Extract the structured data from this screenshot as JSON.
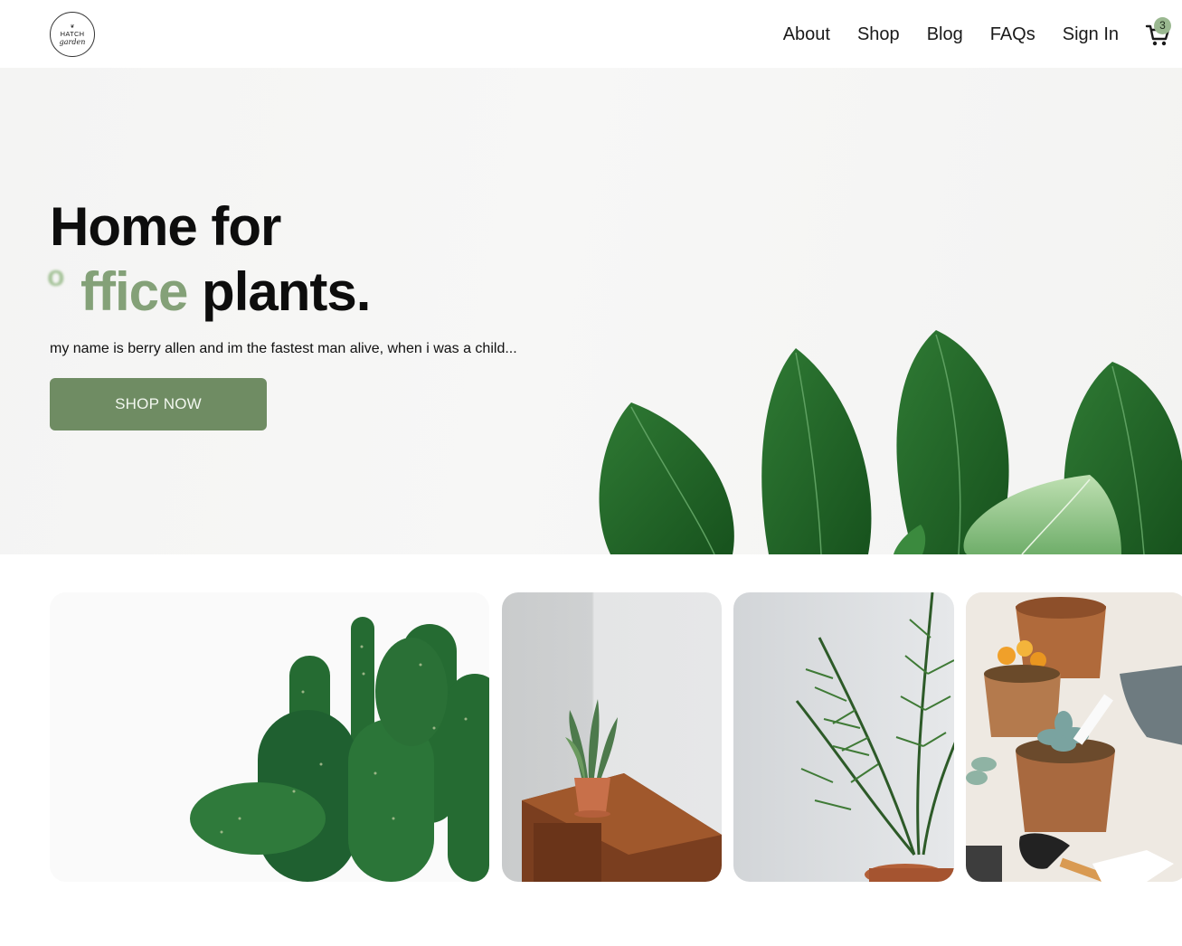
{
  "header": {
    "logo": {
      "line1": "HATCH",
      "line2": "garden"
    },
    "nav": [
      {
        "label": "About"
      },
      {
        "label": "Shop"
      },
      {
        "label": "Blog"
      },
      {
        "label": "FAQs"
      },
      {
        "label": "Sign In"
      }
    ],
    "cart": {
      "icon": "cart-icon",
      "count": "3"
    }
  },
  "hero": {
    "title_line1": "Home for",
    "title_o": "o",
    "title_ffice": "ffice",
    "title_plants": " plants.",
    "description": "my name is berry allen and im the fastest man alive, when i was a child...",
    "cta_label": "SHOP NOW"
  },
  "colors": {
    "accent": "#6f8c63",
    "accent_light": "#84a178",
    "badge": "#9ab890",
    "text": "#111111"
  }
}
